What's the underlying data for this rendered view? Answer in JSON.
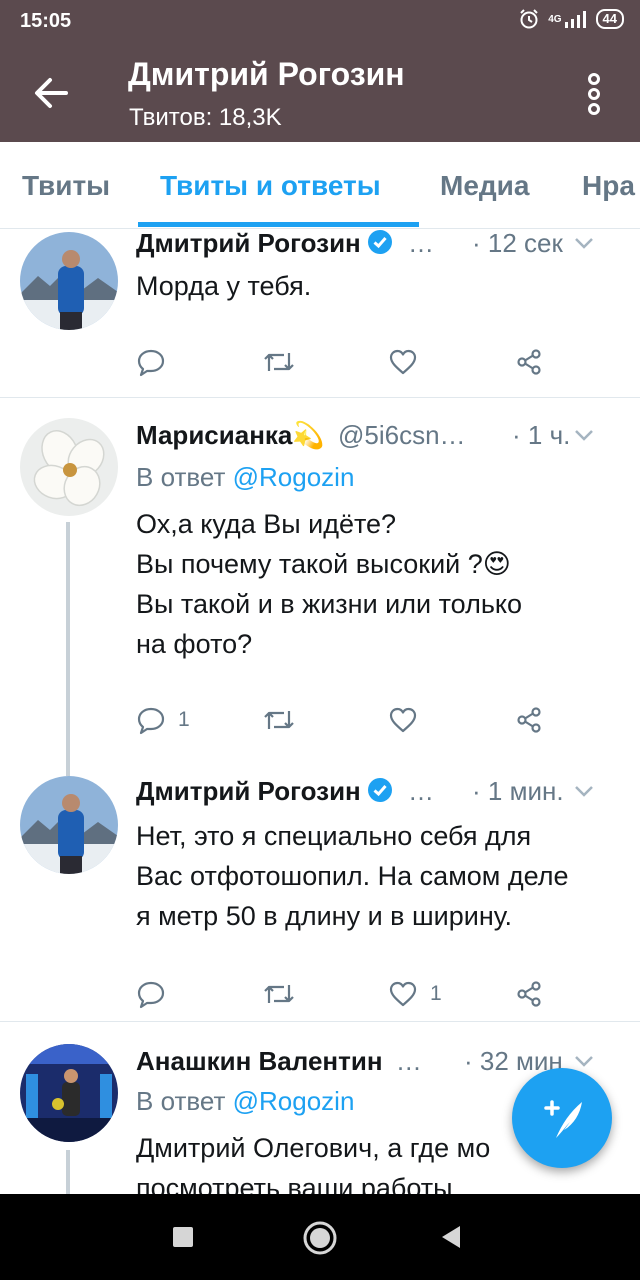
{
  "status_bar": {
    "time": "15:05",
    "network": "4G",
    "battery": "44"
  },
  "header": {
    "title": "Дмитрий Рогозин",
    "subtitle": "Твитов: 18,3K"
  },
  "tabs": [
    {
      "label": "Твиты",
      "active": false
    },
    {
      "label": "Твиты и ответы",
      "active": true
    },
    {
      "label": "Медиа",
      "active": false
    },
    {
      "label": "Нра",
      "active": false
    }
  ],
  "tweets": [
    {
      "name": "Дмитрий Рогозин",
      "verified": true,
      "handle": "…",
      "time": "· 12 сек",
      "text": "Морда у тебя.",
      "counts": {
        "reply": "",
        "retweet": "",
        "like": ""
      }
    },
    {
      "name": "Марисианка💫",
      "verified": false,
      "handle": "@5i6csn…",
      "time": "· 1 ч.",
      "reply_to_prefix": "В ответ",
      "reply_to": "@Rogozin",
      "text": "Ох,а куда Вы идёте?\nВы почему такой высокий ?😍\nВы такой и в жизни или только\nна фото?",
      "counts": {
        "reply": "1",
        "retweet": "",
        "like": ""
      }
    },
    {
      "name": "Дмитрий Рогозин",
      "verified": true,
      "handle": "…",
      "time": "· 1 мин.",
      "text": "Нет, это я специально себя для\nВас отфотошопил. На самом деле\nя метр 50 в длину и в ширину.",
      "counts": {
        "reply": "",
        "retweet": "",
        "like": "1"
      }
    },
    {
      "name": "Анашкин Валентин",
      "verified": false,
      "handle": "…",
      "time": "· 32 мин",
      "reply_to_prefix": "В ответ",
      "reply_to": "@Rogozin",
      "text": "Дмитрий Олегович, а где мо\nпосмотреть ваши работы,"
    }
  ],
  "icons": {
    "back": "arrow-left-icon",
    "more": "more-vertical-icon",
    "verified": "verified-badge-icon",
    "reply": "reply-icon",
    "retweet": "retweet-icon",
    "like": "heart-icon",
    "share": "share-icon",
    "compose": "compose-tweet-icon",
    "nav_recents": "square-icon",
    "nav_home": "circle-icon",
    "nav_back": "triangle-back-icon"
  },
  "colors": {
    "appbar": "#5b4a4e",
    "accent": "#1da1f2",
    "secondary_text": "#657786"
  }
}
